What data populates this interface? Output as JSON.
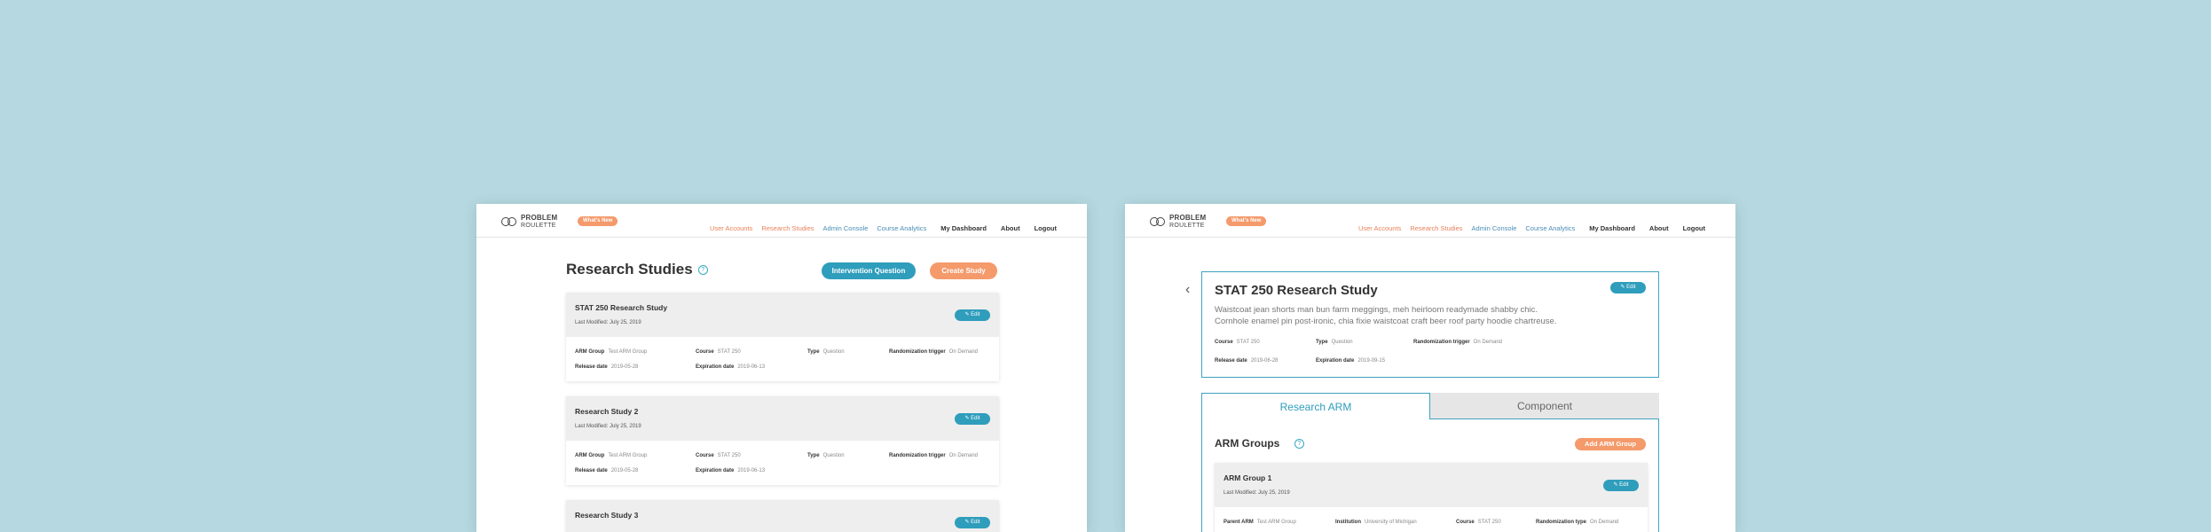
{
  "header": {
    "logo_line1": "PROBLEM",
    "logo_line2": "ROULETTE",
    "whats_new": "What's New",
    "nav": {
      "user_accounts": "User Accounts",
      "research_studies": "Research Studies",
      "admin_console": "Admin Console",
      "course_analytics": "Course Analytics",
      "my_dashboard": "My Dashboard",
      "about": "About",
      "logout": "Logout"
    }
  },
  "left": {
    "title": "Research Studies",
    "help": "?",
    "intervention_button": "Intervention Question",
    "create_button": "Create Study",
    "studies": [
      {
        "title": "STAT 250 Research Study",
        "modified": "Last Modified: July 25, 2019",
        "edit": "✎ Edit",
        "arm_group_label": "ARM Group",
        "arm_group_value": "Test ARM Group",
        "course_label": "Course",
        "course_value": "STAT 250",
        "type_label": "Type",
        "type_value": "Question",
        "trigger_label": "Randomization trigger",
        "trigger_value": "On Demand",
        "release_label": "Release date",
        "release_value": "2019-05-28",
        "expiration_label": "Expiration date",
        "expiration_value": "2019-06-13"
      },
      {
        "title": "Research Study 2",
        "modified": "Last Modified: July 25, 2019",
        "edit": "✎ Edit",
        "arm_group_label": "ARM Group",
        "arm_group_value": "Test ARM Group",
        "course_label": "Course",
        "course_value": "STAT 250",
        "type_label": "Type",
        "type_value": "Question",
        "trigger_label": "Randomization trigger",
        "trigger_value": "On Demand",
        "release_label": "Release date",
        "release_value": "2019-05-28",
        "expiration_label": "Expiration date",
        "expiration_value": "2019-06-13"
      },
      {
        "title": "Research Study 3",
        "edit": "✎ Edit"
      }
    ]
  },
  "right": {
    "back": "‹",
    "title": "STAT 250 Research Study",
    "edit": "✎ Edit",
    "description_1": "Waistcoat jean shorts man bun farm meggings, meh heirloom readymade shabby chic.",
    "description_2": "Cornhole enamel pin post-ironic, chia fixie waistcoat craft beer roof party hoodie chartreuse.",
    "course_label": "Course",
    "course_value": "STAT 250",
    "type_label": "Type",
    "type_value": "Question",
    "trigger_label": "Randomization trigger",
    "trigger_value": "On Demand",
    "release_label": "Release date",
    "release_value": "2019-06-28",
    "expiration_label": "Expiration date",
    "expiration_value": "2019-09-15",
    "tab_research_arm": "Research ARM",
    "tab_component": "Component",
    "arm_groups_title": "ARM Groups",
    "help": "?",
    "add_arm_group": "Add ARM Group",
    "arm_group": {
      "title": "ARM Group 1",
      "modified": "Last Modified: July 25, 2019",
      "edit": "✎ Edit",
      "parent_label": "Parent ARM",
      "parent_value": "Test ARM Group",
      "institution_label": "Institution",
      "institution_value": "University of Michigan",
      "course_label": "Course",
      "course_value": "STAT 250",
      "rand_type_label": "Randomization type",
      "rand_type_value": "On Demand"
    }
  }
}
